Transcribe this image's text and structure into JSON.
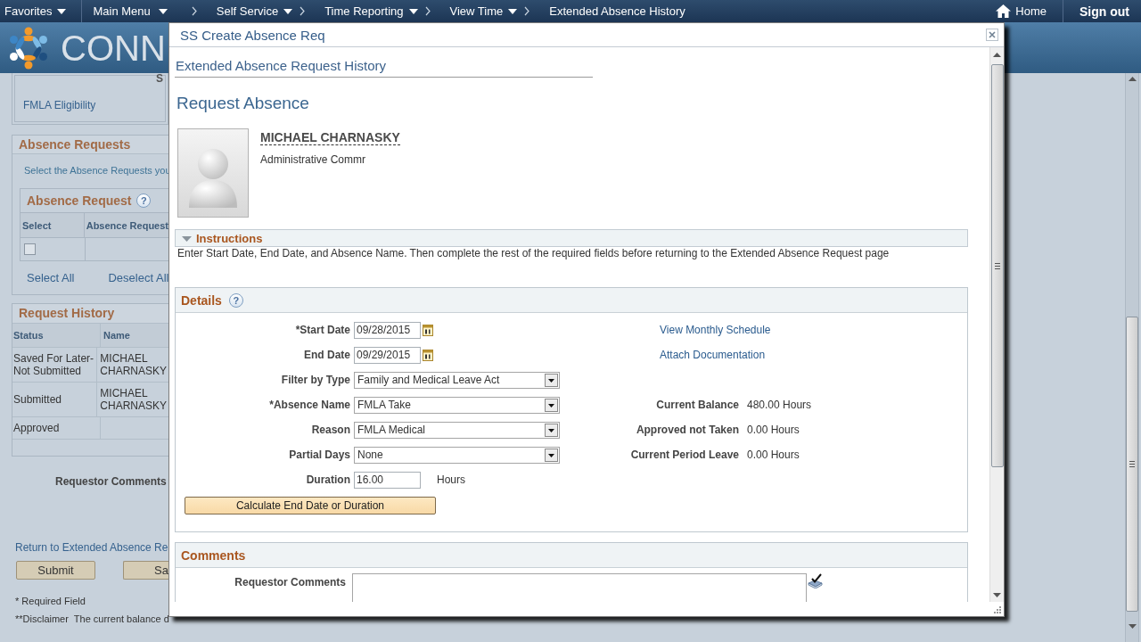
{
  "nav_bar": {
    "menus": [
      {
        "label": "Favorites",
        "dropdown": true
      },
      {
        "label": "Main Menu",
        "dropdown": true
      }
    ],
    "breadcrumbs": [
      {
        "label": "Self Service",
        "dropdown": true
      },
      {
        "label": "Time Reporting",
        "dropdown": true
      },
      {
        "label": "View Time",
        "dropdown": true
      },
      {
        "label": "Extended Absence History",
        "dropdown": false
      }
    ],
    "home": "Home",
    "sign_out": "Sign out"
  },
  "header": {
    "logo_text": "CONN"
  },
  "background_page": {
    "eligibility_box": {
      "heading": "S",
      "link": "FMLA Eligibility"
    },
    "absence_requests": {
      "title": "Absence Requests",
      "instruction": "Select the Absence Requests you",
      "grid": {
        "title": "Absence Request",
        "help": "?",
        "columns": [
          "Select",
          "Absence Request"
        ],
        "rows": [
          {
            "checked": false
          }
        ]
      },
      "links": [
        "Select All",
        "Deselect All"
      ]
    },
    "request_history": {
      "title": "Request History",
      "columns": [
        "Status",
        "Name"
      ],
      "rows": [
        {
          "status": "Saved For Later-Not Submitted",
          "name": "MICHAEL CHARNASKY"
        },
        {
          "status": "Submitted",
          "name": "MICHAEL CHARNASKY"
        },
        {
          "status": "Approved"
        }
      ]
    },
    "comments_label": "Requestor Comments",
    "return_link": "Return to Extended Absence Re",
    "buttons": [
      "Submit",
      "Sa"
    ],
    "required_note": "* Required Field",
    "disclaimer": "**Disclaimer  The current balance d"
  },
  "modal": {
    "title": "SS Create Absence Req",
    "page_link": "Extended Absence Request History",
    "heading": "Request Absence",
    "employee": {
      "name": "MICHAEL CHARNASKY",
      "job_title": "Administrative Commr"
    },
    "instructions": {
      "title": "Instructions",
      "expanded": true,
      "text": "Enter Start Date, End Date, and Absence Name. Then complete the rest of the required fields before returning to the Extended Absence Request page"
    },
    "details": {
      "title": "Details",
      "help": "?",
      "fields": [
        {
          "kind": "date",
          "label": "*Start Date",
          "value": "09/28/2015"
        },
        {
          "kind": "date",
          "label": "End Date",
          "value": "09/29/2015"
        },
        {
          "kind": "select",
          "label": "Filter by Type",
          "value": "Family and Medical Leave Act"
        },
        {
          "kind": "select",
          "label": "*Absence Name",
          "value": "FMLA Take"
        },
        {
          "kind": "select",
          "label": "Reason",
          "value": "FMLA Medical"
        },
        {
          "kind": "select",
          "label": "Partial Days",
          "value": "None"
        },
        {
          "kind": "number",
          "label": "Duration",
          "value": "16.00",
          "unit": "Hours"
        }
      ],
      "links": [
        "View Monthly Schedule",
        "Attach Documentation"
      ],
      "balances": [
        {
          "label": "Current Balance",
          "value": "480.00 Hours"
        },
        {
          "label": "Approved not Taken",
          "value": "0.00 Hours"
        },
        {
          "label": "Current Period Leave",
          "value": "0.00 Hours"
        }
      ],
      "button": "Calculate End Date or Duration"
    },
    "comments": {
      "title": "Comments",
      "fields": [
        {
          "label": "Requestor Comments"
        }
      ]
    }
  }
}
